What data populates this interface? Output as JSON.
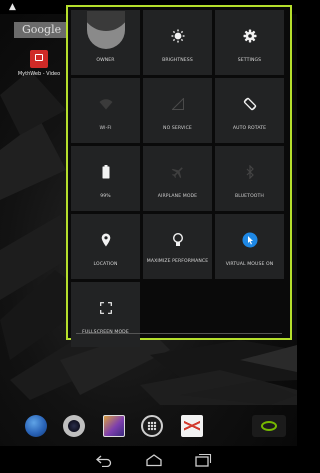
{
  "status_bar": {
    "warning_icon": "warning-icon"
  },
  "home": {
    "search_label": "Google",
    "app": {
      "label": "MythWeb - Video",
      "icon": "tv-icon"
    }
  },
  "quick_settings": {
    "accent_color": "#b5df2c",
    "tiles": [
      {
        "label": "OWNER",
        "icon": "user-avatar",
        "active": true
      },
      {
        "label": "BRIGHTNESS",
        "icon": "brightness-icon",
        "active": true
      },
      {
        "label": "SETTINGS",
        "icon": "settings-gear-icon",
        "active": true
      },
      {
        "label": "WI-FI",
        "icon": "wifi-icon",
        "active": false
      },
      {
        "label": "NO SERVICE",
        "icon": "signal-icon",
        "active": false
      },
      {
        "label": "AUTO ROTATE",
        "icon": "rotate-icon",
        "active": true
      },
      {
        "label": "99%",
        "icon": "battery-icon",
        "active": true
      },
      {
        "label": "AIRPLANE MODE",
        "icon": "airplane-icon",
        "active": false
      },
      {
        "label": "BLUETOOTH",
        "icon": "bluetooth-icon",
        "active": false
      },
      {
        "label": "LOCATION",
        "icon": "location-pin-icon",
        "active": true
      },
      {
        "label": "MAXIMIZE PERFORMANCE",
        "icon": "lightbulb-icon",
        "active": true
      },
      {
        "label": "VIRTUAL MOUSE ON",
        "icon": "virtual-mouse-icon",
        "active": true,
        "accent": "#1e88e5"
      },
      {
        "label": "FULLSCREEN MODE",
        "icon": "fullscreen-icon",
        "active": true
      }
    ]
  },
  "dock": {
    "items": [
      "browser-globe-icon",
      "camera-icon",
      "gallery-icon",
      "all-apps-icon",
      "gmail-icon",
      "nvidia-icon"
    ]
  },
  "nav_bar": {
    "items": [
      "back-icon",
      "home-icon",
      "recent-apps-icon"
    ]
  }
}
